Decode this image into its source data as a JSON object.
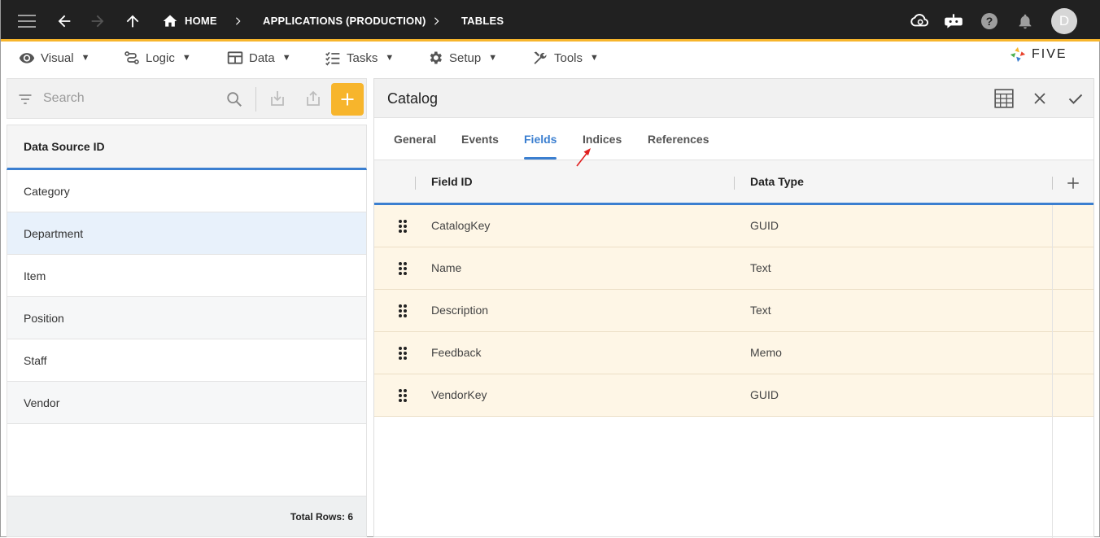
{
  "topbar": {
    "breadcrumbs": [
      "HOME",
      "APPLICATIONS (PRODUCTION)",
      "TABLES"
    ],
    "avatar_initial": "D",
    "icons": [
      "menu-icon",
      "back-arrow-icon",
      "forward-arrow-icon",
      "up-arrow-icon",
      "home-icon",
      "chevron-right-icon",
      "cloud-sync-icon",
      "chat-bot-icon",
      "help-icon",
      "bell-icon"
    ],
    "accent_color": "#f7b52c"
  },
  "menubar": {
    "items": [
      "Visual",
      "Logic",
      "Data",
      "Tasks",
      "Setup",
      "Tools"
    ],
    "logo_text": "FIVE"
  },
  "left_panel": {
    "search_placeholder": "Search",
    "column_header": "Data Source ID",
    "rows": [
      "Category",
      "Department",
      "Item",
      "Position",
      "Staff",
      "Vendor"
    ],
    "selected_row": "Department",
    "footer": "Total Rows: 6"
  },
  "right_panel": {
    "title": "Catalog",
    "tabs": [
      "General",
      "Events",
      "Fields",
      "Indices",
      "References"
    ],
    "active_tab": "Fields",
    "columns": [
      "Field ID",
      "Data Type"
    ],
    "fields": [
      {
        "id": "CatalogKey",
        "type": "GUID"
      },
      {
        "id": "Name",
        "type": "Text"
      },
      {
        "id": "Description",
        "type": "Text"
      },
      {
        "id": "Feedback",
        "type": "Memo"
      },
      {
        "id": "VendorKey",
        "type": "GUID"
      }
    ],
    "accent_color": "#3b7fd0",
    "row_highlight_color": "#fef6e6"
  }
}
